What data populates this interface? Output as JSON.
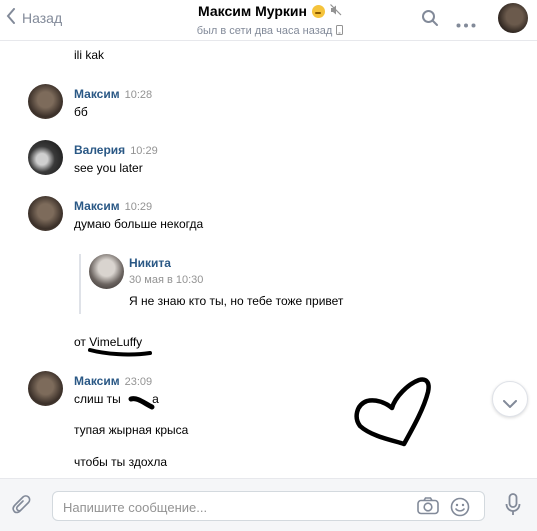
{
  "header": {
    "back_label": "Назад",
    "title": "Максим Муркин",
    "status": "был в сети два часа назад"
  },
  "messages": [
    {
      "text": "ili kak"
    },
    {
      "sender": "Максим",
      "time": "10:28",
      "text": "бб"
    },
    {
      "sender": "Валерия",
      "time": "10:29",
      "text": "see you later"
    },
    {
      "sender": "Максим",
      "time": "10:29",
      "text": "думаю больше некогда"
    },
    {
      "quote": {
        "sender": "Никита",
        "date": "30 мая в 10:30",
        "text": "Я не знаю кто ты, но тебе тоже привет"
      }
    },
    {
      "text": "от VimeLuffy"
    },
    {
      "sender": "Максим",
      "time": "23:09",
      "text": "слиш ты ",
      "text2": "а"
    },
    {
      "text": "тупая жырная крыса"
    },
    {
      "text": "чтобы ты здохла"
    }
  ],
  "composer": {
    "placeholder": "Напишите сообщение..."
  },
  "colors": {
    "sender_name": "#2a5885",
    "timestamp": "#939393",
    "icon_gray": "#828a99"
  }
}
